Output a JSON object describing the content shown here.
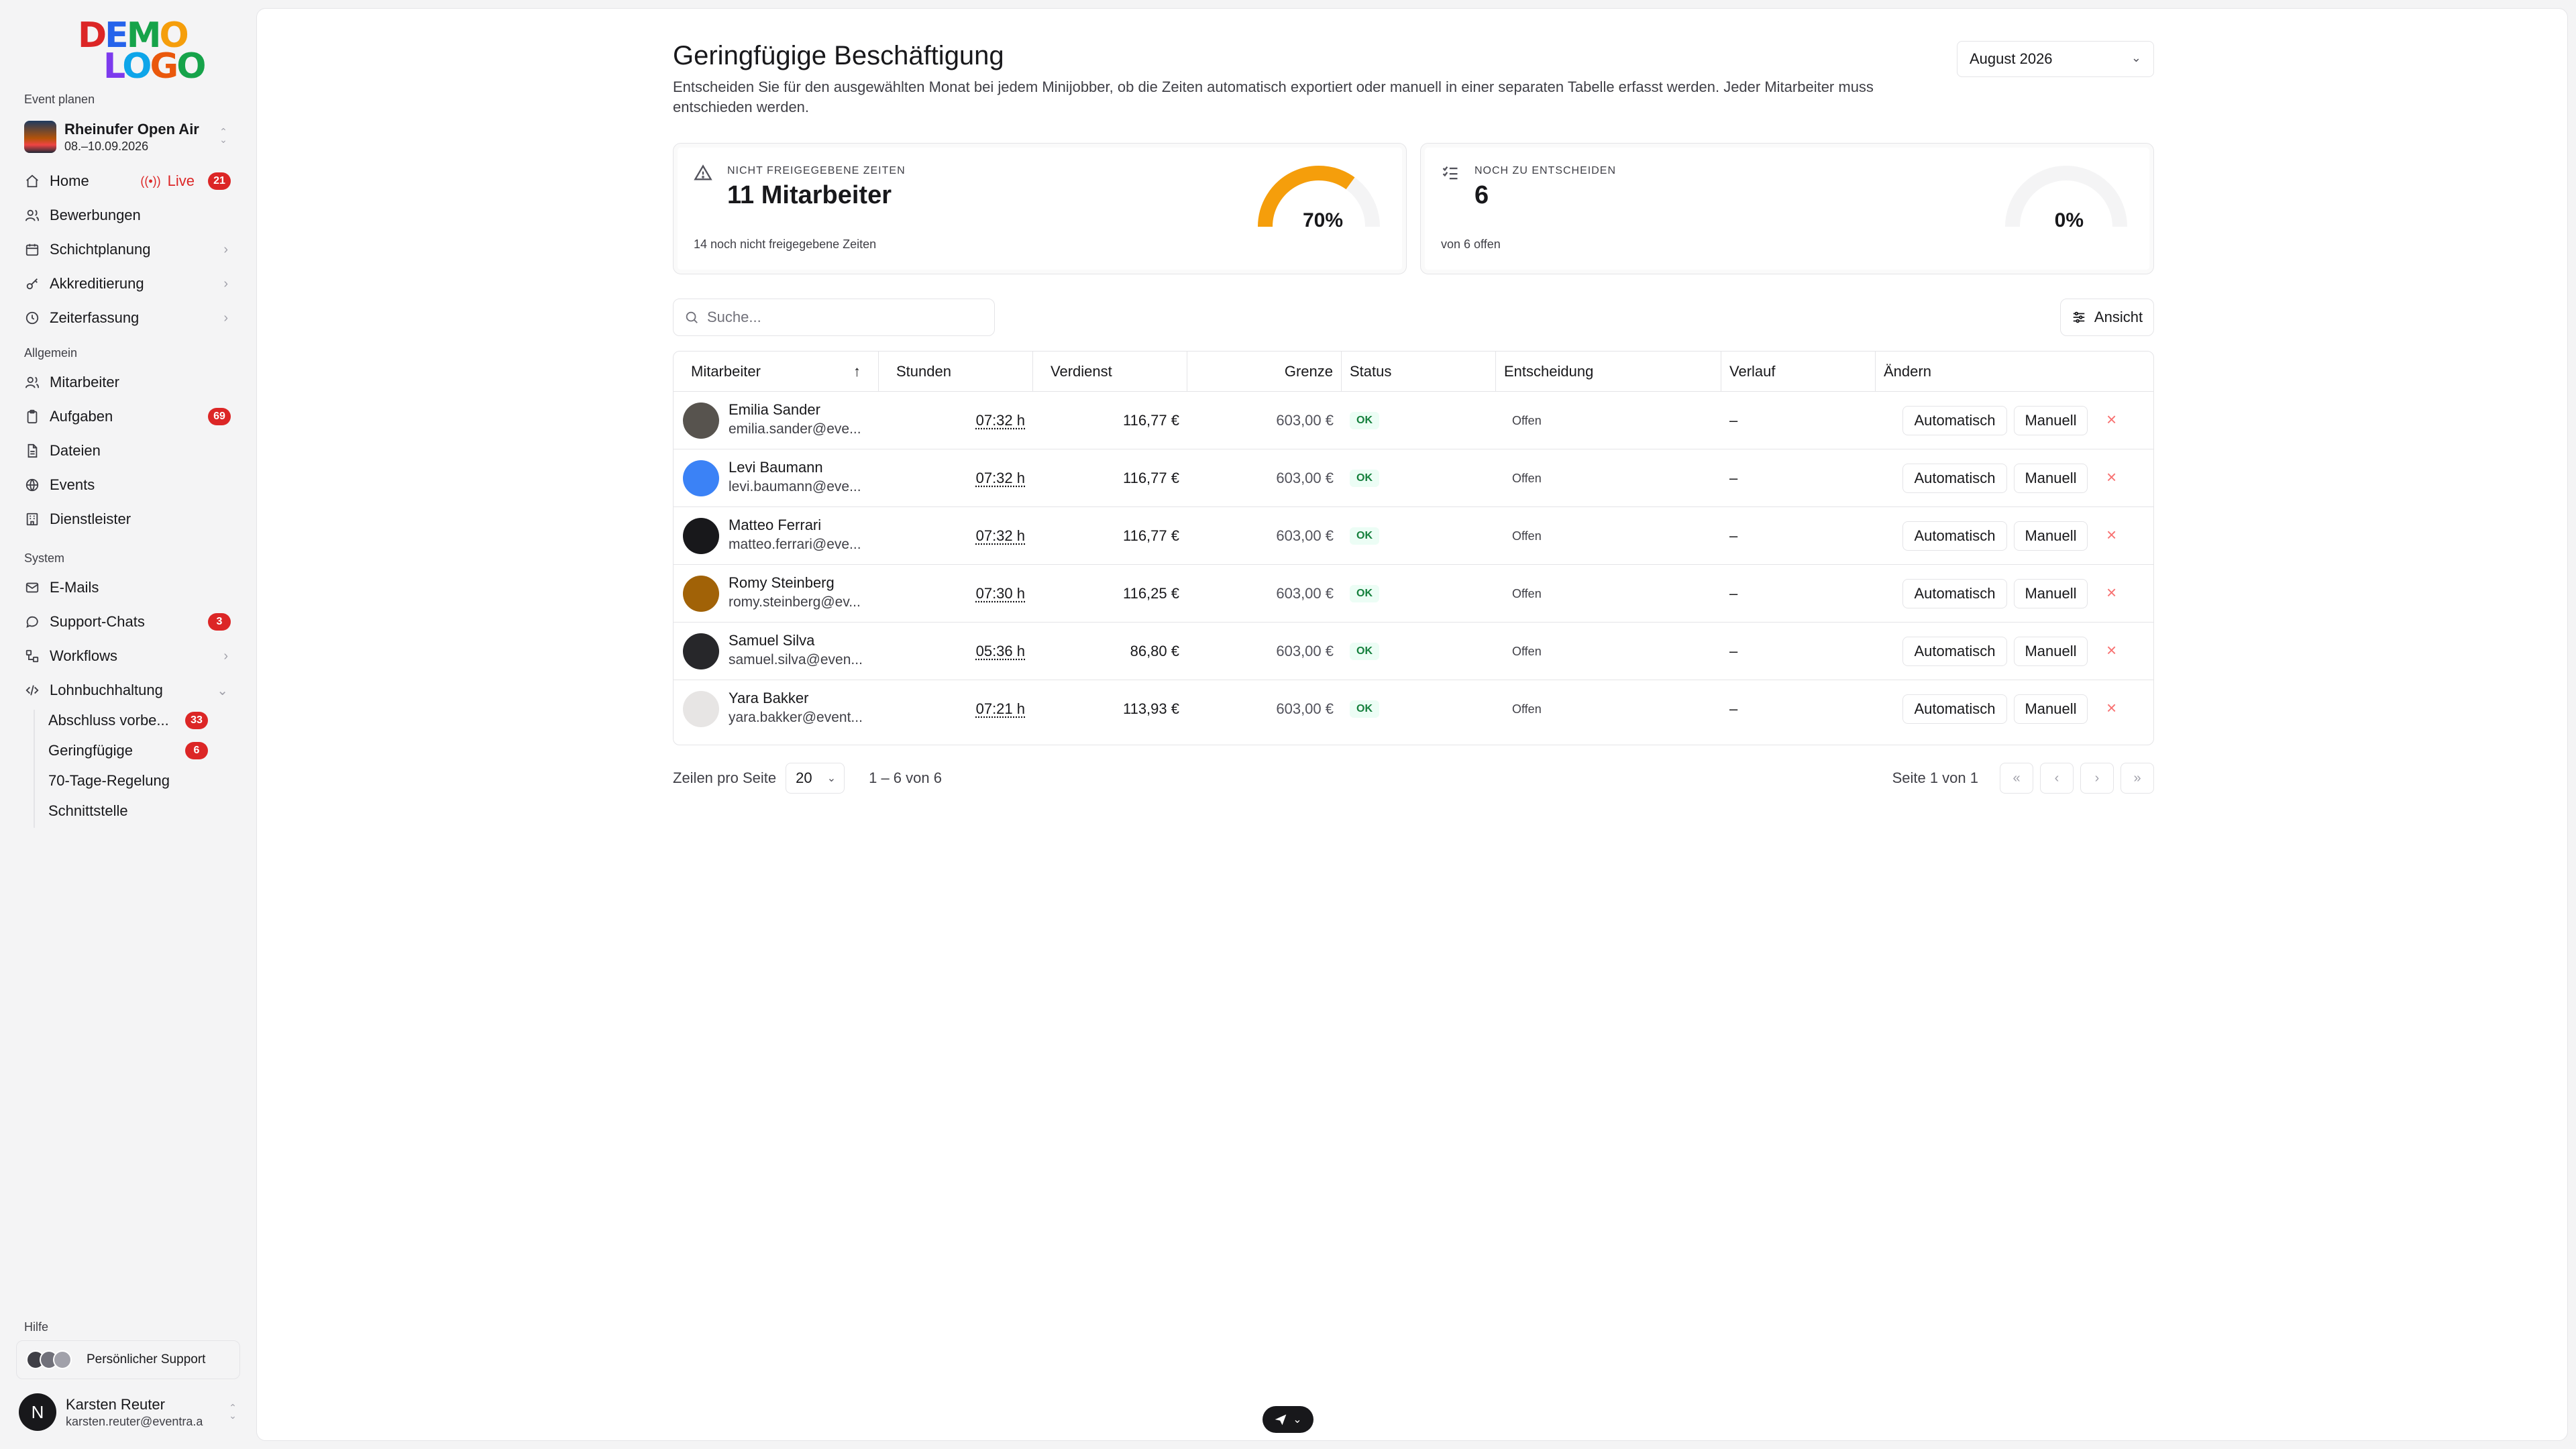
{
  "logo": {
    "row1": "DEMO",
    "row2": "LOGO"
  },
  "sidebar": {
    "section_event": "Event planen",
    "event": {
      "name": "Rheinufer Open Air",
      "date": "08.–10.09.2026"
    },
    "items_event": [
      {
        "label": "Home",
        "icon": "home-icon",
        "live": "Live",
        "badge": "21"
      },
      {
        "label": "Bewerbungen",
        "icon": "users-icon"
      },
      {
        "label": "Schichtplanung",
        "icon": "calendar-icon",
        "chevron": "›"
      },
      {
        "label": "Akkreditierung",
        "icon": "key-icon",
        "chevron": "›"
      },
      {
        "label": "Zeiterfassung",
        "icon": "clock-icon",
        "chevron": "›"
      }
    ],
    "section_general": "Allgemein",
    "items_general": [
      {
        "label": "Mitarbeiter",
        "icon": "users-icon"
      },
      {
        "label": "Aufgaben",
        "icon": "clipboard-icon",
        "badge": "69"
      },
      {
        "label": "Dateien",
        "icon": "file-icon"
      },
      {
        "label": "Events",
        "icon": "events-icon"
      },
      {
        "label": "Dienstleister",
        "icon": "building-icon"
      }
    ],
    "section_system": "System",
    "items_system": [
      {
        "label": "E-Mails",
        "icon": "mail-icon"
      },
      {
        "label": "Support-Chats",
        "icon": "chat-icon",
        "badge": "3"
      },
      {
        "label": "Workflows",
        "icon": "workflow-icon",
        "chevron": "›"
      },
      {
        "label": "Lohnbuchhaltung",
        "icon": "code-icon",
        "chevron": "⌄"
      }
    ],
    "subitems": [
      {
        "label": "Abschluss vorbe...",
        "badge": "33"
      },
      {
        "label": "Geringfügige",
        "badge": "6"
      },
      {
        "label": "70-Tage-Regelung"
      },
      {
        "label": "Schnittstelle"
      }
    ],
    "section_help": "Hilfe",
    "support_label": "Persönlicher Support",
    "user": {
      "initial": "N",
      "name": "Karsten Reuter",
      "email": "karsten.reuter@eventra.a"
    }
  },
  "header": {
    "title": "Geringfügige Beschäftigung",
    "description": "Entscheiden Sie für den ausgewählten Monat bei jedem Minijobber, ob die Zeiten automatisch exportiert oder manuell in einer separaten Tabelle erfasst werden. Jeder Mitarbeiter muss entschieden werden.",
    "month": "August 2026"
  },
  "stats": [
    {
      "label": "Nicht freigegebene Zeiten",
      "value": "11 Mitarbeiter",
      "foot": "14 noch nicht freigegebene Zeiten",
      "percent": 70,
      "percent_label": "70%",
      "color": "#f59e0b",
      "icon": "warning-icon"
    },
    {
      "label": "Noch zu entscheiden",
      "value": "6",
      "foot": "von 6 offen",
      "percent": 0,
      "percent_label": "0%",
      "color": "#f59e0b",
      "icon": "checklist-icon"
    }
  ],
  "search": {
    "placeholder": "Suche..."
  },
  "view_button": "Ansicht",
  "table": {
    "columns": [
      "Mitarbeiter",
      "Stunden",
      "Verdienst",
      "Grenze",
      "Status",
      "Entscheidung",
      "Verlauf",
      "Ändern"
    ],
    "sort_icon": "↑",
    "rows": [
      {
        "name": "Emilia Sander",
        "email": "emilia.sander@eve...",
        "hours": "07:32 h",
        "earnings": "116,77 €",
        "limit": "603,00 €",
        "status": "OK",
        "decision": "Offen",
        "history": "–"
      },
      {
        "name": "Levi Baumann",
        "email": "levi.baumann@eve...",
        "hours": "07:32 h",
        "earnings": "116,77 €",
        "limit": "603,00 €",
        "status": "OK",
        "decision": "Offen",
        "history": "–"
      },
      {
        "name": "Matteo Ferrari",
        "email": "matteo.ferrari@eve...",
        "hours": "07:32 h",
        "earnings": "116,77 €",
        "limit": "603,00 €",
        "status": "OK",
        "decision": "Offen",
        "history": "–"
      },
      {
        "name": "Romy Steinberg",
        "email": "romy.steinberg@ev...",
        "hours": "07:30 h",
        "earnings": "116,25 €",
        "limit": "603,00 €",
        "status": "OK",
        "decision": "Offen",
        "history": "–"
      },
      {
        "name": "Samuel Silva",
        "email": "samuel.silva@even...",
        "hours": "05:36 h",
        "earnings": "86,80 €",
        "limit": "603,00 €",
        "status": "OK",
        "decision": "Offen",
        "history": "–"
      },
      {
        "name": "Yara Bakker",
        "email": "yara.bakker@event...",
        "hours": "07:21 h",
        "earnings": "113,93 €",
        "limit": "603,00 €",
        "status": "OK",
        "decision": "Offen",
        "history": "–"
      }
    ],
    "btn_auto": "Automatisch",
    "btn_manual": "Manuell",
    "btn_remove": "×"
  },
  "pagination": {
    "rows_per_page_label": "Zeilen pro Seite",
    "rows_per_page": "20",
    "range": "1 – 6 von 6",
    "page_label": "Seite 1 von 1",
    "first": "«",
    "prev": "‹",
    "next": "›",
    "last": "»"
  }
}
